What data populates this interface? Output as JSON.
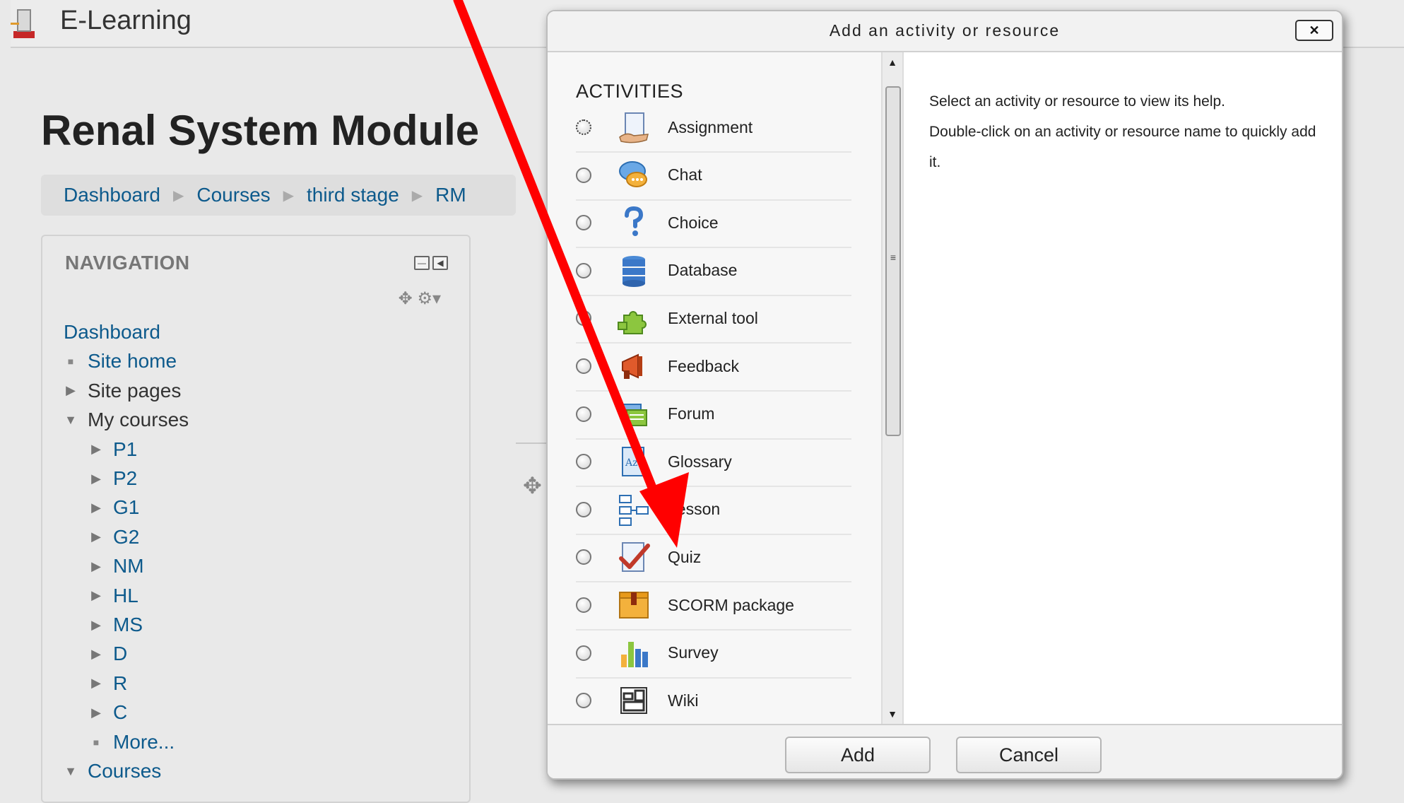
{
  "site": {
    "name": "E-Learning"
  },
  "page": {
    "title": "Renal System Module"
  },
  "breadcrumb": [
    "Dashboard",
    "Courses",
    "third stage",
    "RM"
  ],
  "navigation": {
    "title": "NAVIGATION",
    "items": [
      {
        "label": "Dashboard",
        "glyph": "",
        "level": 0,
        "link": true
      },
      {
        "label": "Site home",
        "glyph": "bullet",
        "level": 1,
        "link": true
      },
      {
        "label": "Site pages",
        "glyph": "collapsed",
        "level": 1,
        "link": false
      },
      {
        "label": "My courses",
        "glyph": "expanded",
        "level": 1,
        "link": false
      },
      {
        "label": "P1",
        "glyph": "collapsed",
        "level": 2,
        "link": true
      },
      {
        "label": "P2",
        "glyph": "collapsed",
        "level": 2,
        "link": true
      },
      {
        "label": "G1",
        "glyph": "collapsed",
        "level": 2,
        "link": true
      },
      {
        "label": "G2",
        "glyph": "collapsed",
        "level": 2,
        "link": true
      },
      {
        "label": "NM",
        "glyph": "collapsed",
        "level": 2,
        "link": true
      },
      {
        "label": "HL",
        "glyph": "collapsed",
        "level": 2,
        "link": true
      },
      {
        "label": "MS",
        "glyph": "collapsed",
        "level": 2,
        "link": true
      },
      {
        "label": "D",
        "glyph": "collapsed",
        "level": 2,
        "link": true
      },
      {
        "label": "R",
        "glyph": "collapsed",
        "level": 2,
        "link": true
      },
      {
        "label": "C",
        "glyph": "collapsed",
        "level": 2,
        "link": true
      },
      {
        "label": "More...",
        "glyph": "bullet",
        "level": 2,
        "link": true
      },
      {
        "label": "Courses",
        "glyph": "expanded",
        "level": 1,
        "link": true
      }
    ]
  },
  "dialog": {
    "title": "Add an activity or resource",
    "close_label": "✕",
    "section_title": "ACTIVITIES",
    "activities": [
      {
        "label": "Assignment",
        "icon": "assignment-icon"
      },
      {
        "label": "Chat",
        "icon": "chat-icon"
      },
      {
        "label": "Choice",
        "icon": "choice-icon"
      },
      {
        "label": "Database",
        "icon": "database-icon"
      },
      {
        "label": "External tool",
        "icon": "external-tool-icon"
      },
      {
        "label": "Feedback",
        "icon": "feedback-icon"
      },
      {
        "label": "Forum",
        "icon": "forum-icon"
      },
      {
        "label": "Glossary",
        "icon": "glossary-icon"
      },
      {
        "label": "Lesson",
        "icon": "lesson-icon"
      },
      {
        "label": "Quiz",
        "icon": "quiz-icon"
      },
      {
        "label": "SCORM package",
        "icon": "scorm-package-icon"
      },
      {
        "label": "Survey",
        "icon": "survey-icon"
      },
      {
        "label": "Wiki",
        "icon": "wiki-icon"
      }
    ],
    "help": {
      "line1": "Select an activity or resource to view its help.",
      "line2": "Double-click on an activity or resource name to quickly add it."
    },
    "buttons": {
      "add": "Add",
      "cancel": "Cancel"
    }
  },
  "annotation": {
    "arrow_color": "#ff0000",
    "target": "Quiz"
  }
}
